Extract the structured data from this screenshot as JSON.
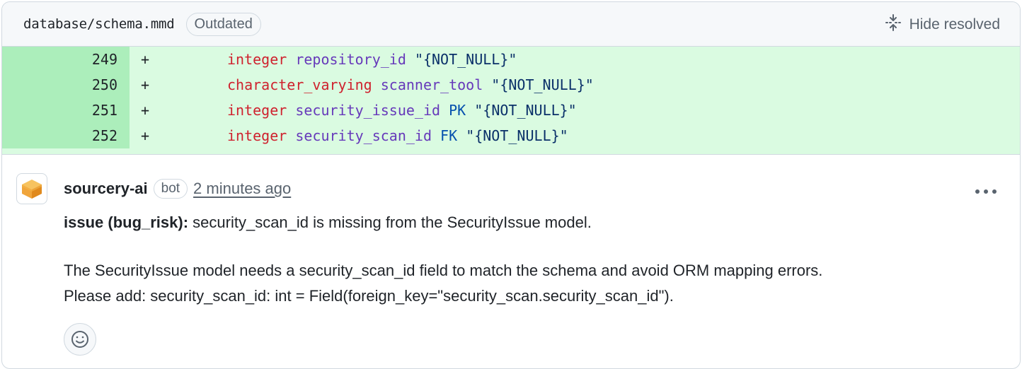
{
  "file": {
    "path": "database/schema.mmd",
    "badge": "Outdated",
    "hide_resolved_label": "Hide resolved"
  },
  "diff": {
    "lines": [
      {
        "num": "249",
        "marker": "+",
        "type": "integer",
        "name": "repository_id",
        "key": "",
        "constraint": "\"{NOT_NULL}\""
      },
      {
        "num": "250",
        "marker": "+",
        "type": "character_varying",
        "name": "scanner_tool",
        "key": "",
        "constraint": "\"{NOT_NULL}\""
      },
      {
        "num": "251",
        "marker": "+",
        "type": "integer",
        "name": "security_issue_id",
        "key": "PK",
        "constraint": "\"{NOT_NULL}\""
      },
      {
        "num": "252",
        "marker": "+",
        "type": "integer",
        "name": "security_scan_id",
        "key": "FK",
        "constraint": "\"{NOT_NULL}\""
      }
    ]
  },
  "comment": {
    "author": "sourcery-ai",
    "badge": "bot",
    "timestamp": "2 minutes ago",
    "menu_icon": "kebab-horizontal-icon",
    "title_bold": "issue (bug_risk):",
    "title_rest": " security_scan_id is missing from the SecurityIssue model.",
    "body_line1": "The SecurityIssue model needs a security_scan_id field to match the schema and avoid ORM mapping errors.",
    "body_line2": "Please add: security_scan_id: int = Field(foreign_key=\"security_scan.security_scan_id\").",
    "reaction_icon": "smiley-icon"
  },
  "colors": {
    "added_line_bg": "#dafbe1",
    "added_number_bg": "#aceebb",
    "keyword": "#cf222e",
    "identifier": "#6639ba",
    "string": "#0a3069",
    "constant": "#0550ae",
    "avatar_orange": "#f0a53b"
  }
}
